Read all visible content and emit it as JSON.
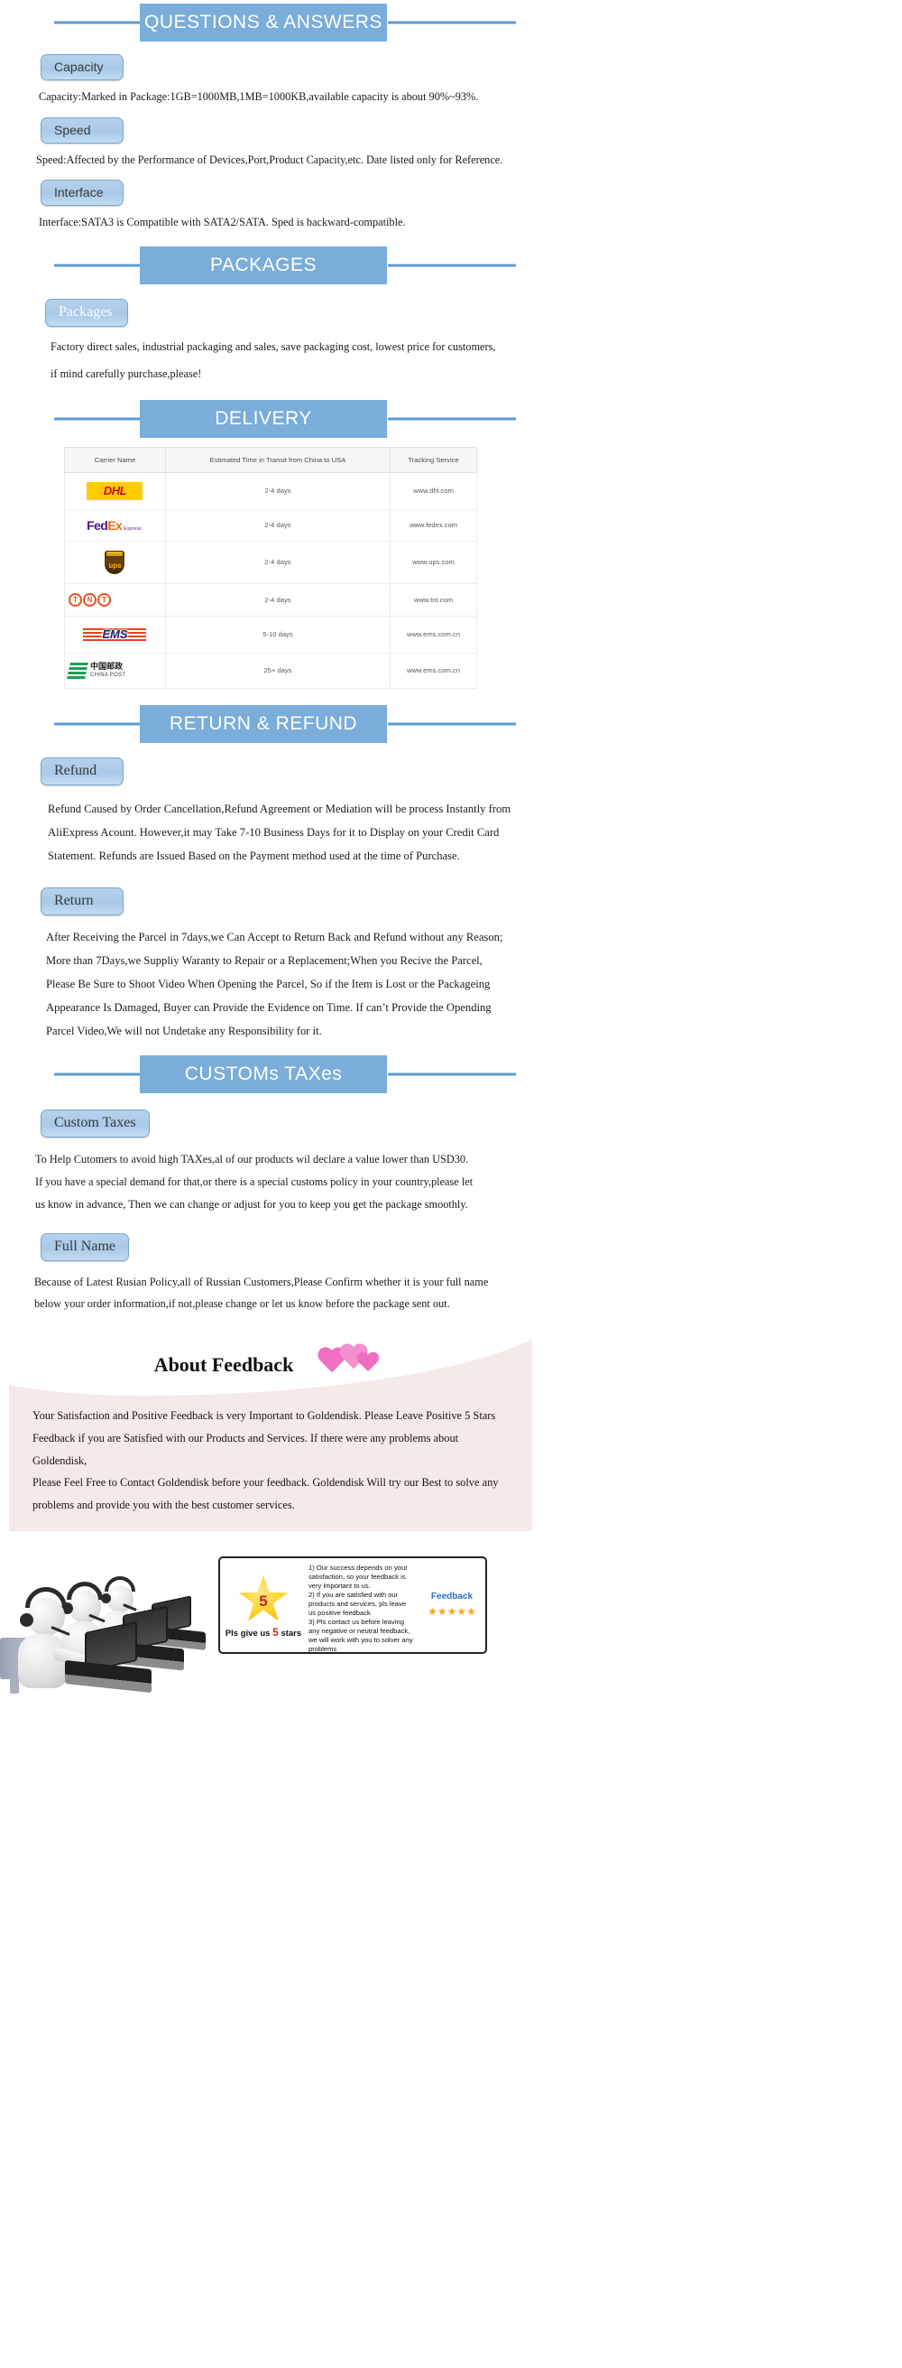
{
  "sections": {
    "qa": {
      "banner": "QUESTIONS & ANSWERS",
      "items": [
        {
          "label": "Capacity",
          "text": "Capacity:Marked in Package:1GB=1000MB,1MB=1000KB,available capacity is about 90%~93%."
        },
        {
          "label": "Speed",
          "text": "Speed:Affected by the Performance of Devices,Port,Product Capacity,etc. Date listed only for Reference."
        },
        {
          "label": "Interface",
          "text": "Interface:SATA3 is Compatible with SATA2/SATA. Sped is backward-compatible."
        }
      ]
    },
    "packages": {
      "banner": "PACKAGES",
      "label": "Packages",
      "line1": "Factory direct sales, industrial packaging and sales, save packaging cost, lowest price for customers,",
      "line2": "if mind carefully purchase,please!"
    },
    "delivery": {
      "banner": "DELIVERY",
      "table": {
        "headers": [
          "Carrier Name",
          "Estimated Time in Transit from China to USA",
          "Tracking Service"
        ],
        "rows": [
          {
            "carrier": "DHL",
            "logo": "dhl-logo",
            "time": "2-4 days",
            "track": "www.dhl.com"
          },
          {
            "carrier": "FedEx",
            "logo": "fedex-logo",
            "time": "2-4 days",
            "track": "www.fedex.com"
          },
          {
            "carrier": "UPS",
            "logo": "ups-logo",
            "time": "2-4 days",
            "track": "www.ups.com"
          },
          {
            "carrier": "TNT",
            "logo": "tnt-logo",
            "time": "2-4 days",
            "track": "www.tnt.com"
          },
          {
            "carrier": "EMS",
            "logo": "ems-logo",
            "time": "5-10 days",
            "track": "www.ems.com.cn"
          },
          {
            "carrier": "China Post",
            "logo": "china-post-logo",
            "time": "25+ days",
            "track": "www.ems.com.cn"
          }
        ]
      },
      "logo_text": {
        "dhl": "DHL",
        "fedex_fed": "Fed",
        "fedex_ex": "Ex",
        "fedex_sub": "Express",
        "ups": "ups",
        "tnt": [
          "T",
          "N",
          "T"
        ],
        "ems": "EMS",
        "china_post_cn": "中国邮政",
        "china_post_en": "CHINA POST"
      }
    },
    "return_refund": {
      "banner": "RETURN & REFUND",
      "refund_label": "Refund",
      "refund_lines": [
        "Refund Caused by Order Cancellation,Refund Agreement or Mediation will be process Instantly from",
        "AliExpress Acount. However,it may Take 7-10 Business Days for it to Display on your Credit Card",
        "Statement. Refunds are Issued Based on the Payment method used at the time of Purchase."
      ],
      "return_label": "Return",
      "return_lines": [
        "After Receiving the Parcel in 7days,we Can Accept to Return Back and Refund without any Reason;",
        "More than 7Days,we Suppliy Waranty to Repair or a Replacement;When you Recive the Parcel,",
        "Please Be Sure to Shoot Video When Opening  the Parcel, So if the Item is Lost or the Packageing",
        "Appearance Is Damaged, Buyer can Provide the Evidence on Time. If can’t Provide the Opending",
        "Parcel Video,We will not Undetake any Responsibility for it."
      ]
    },
    "customs": {
      "banner": "CUSTOMs TAXes",
      "custom_taxes_label": "Custom Taxes",
      "custom_taxes_lines": [
        "To Help Cutomers to avoid high TAXes,al of our products wil declare a value lower than USD30.",
        "If you have a special demand for that,or there is a special customs policy in your country,please let",
        "us know in advance, Then we can change or adjust for you to keep you get the package smoothly."
      ],
      "full_name_label": "Full Name",
      "full_name_lines": [
        "Because of Latest Rusian Policy,all of Russian Customers,Please Confirm whether it is your full name",
        "below your order information,if not,please change or let us know before the package sent out."
      ]
    },
    "feedback": {
      "title": "About Feedback",
      "lines": [
        "Your Satisfaction and Positive Feedback is very Important to Goldendisk. Please Leave Positive 5 Stars",
        "Feedback if you are Satisfied with our Products and Services. If there were any problems about Goldendisk,",
        "Please Feel Free to Contact Goldendisk before your feedback. Goldendisk Will try our Best to solve any",
        "problems and provide you with the best customer services."
      ]
    },
    "footer": {
      "star_number": "5",
      "star_caption_pre": "Pls give us",
      "star_caption_num": "5",
      "star_caption_post": "stars",
      "points": [
        "1) Our success depends on your satisfaction, so your feedback is very important to us.",
        "2) If you are satisfied with our products and services, pls leave us positive feedback",
        "3) Pls contact us before leaving any negative or neutral feedback, we will work with you to solver any problems"
      ],
      "feedback_label": "Feedback",
      "stars_glyph": "★★★★★"
    }
  },
  "colors": {
    "banner_blue": "#7aadd9",
    "rule_blue": "#5b9bd5",
    "pill_blue": "#a8c9e8",
    "feedback_bg": "#f6e9ea",
    "accent_pink": "#f06ec0",
    "star_gold": "#ffd21f"
  }
}
